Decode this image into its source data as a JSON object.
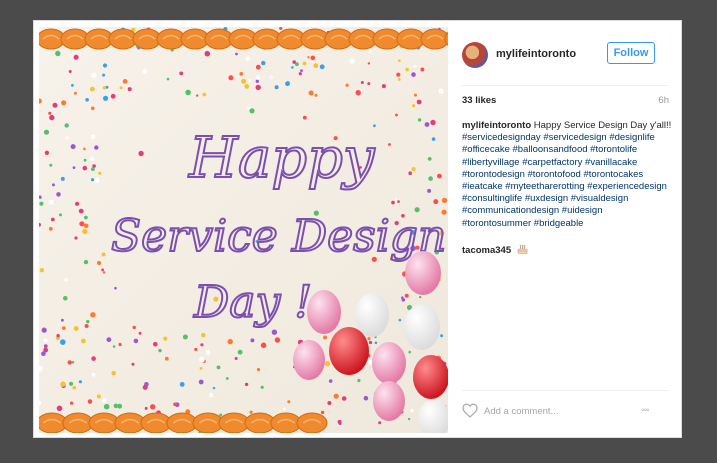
{
  "post": {
    "username": "mylifeintoronto",
    "follow_label": "Follow",
    "likes": "33 likes",
    "age": "6h",
    "caption_user": "mylifeintoronto",
    "caption_text": "Happy Service Design Day y'all!!",
    "hashtags": "#servicedesignday #servicedesign #designlife #officecake #balloonsandfood #torontolife #libertyvillage #carpetfactory #vanillacake #torontodesign #torontofood #torontocakes #ieatcake #myteetharerotting #experiencedesign #consultinglife #uxdesign #visualdesign #communicationdesign #uidesign #torontosummer #bridgeable",
    "comment_user": "tacoma345",
    "comment_emoji": "birthday-cake-emoji",
    "comment_placeholder": "Add a comment...",
    "more_label": "◦◦◦"
  },
  "photo": {
    "cake_text_line1": "Happy",
    "cake_text_line2": "Service Design",
    "cake_text_line3": "Day !"
  },
  "colors": {
    "link": "#003569",
    "follow_blue": "#3897f0",
    "frosting_orange": "#f08a2e",
    "icing_purple": "#7b4fb0"
  }
}
